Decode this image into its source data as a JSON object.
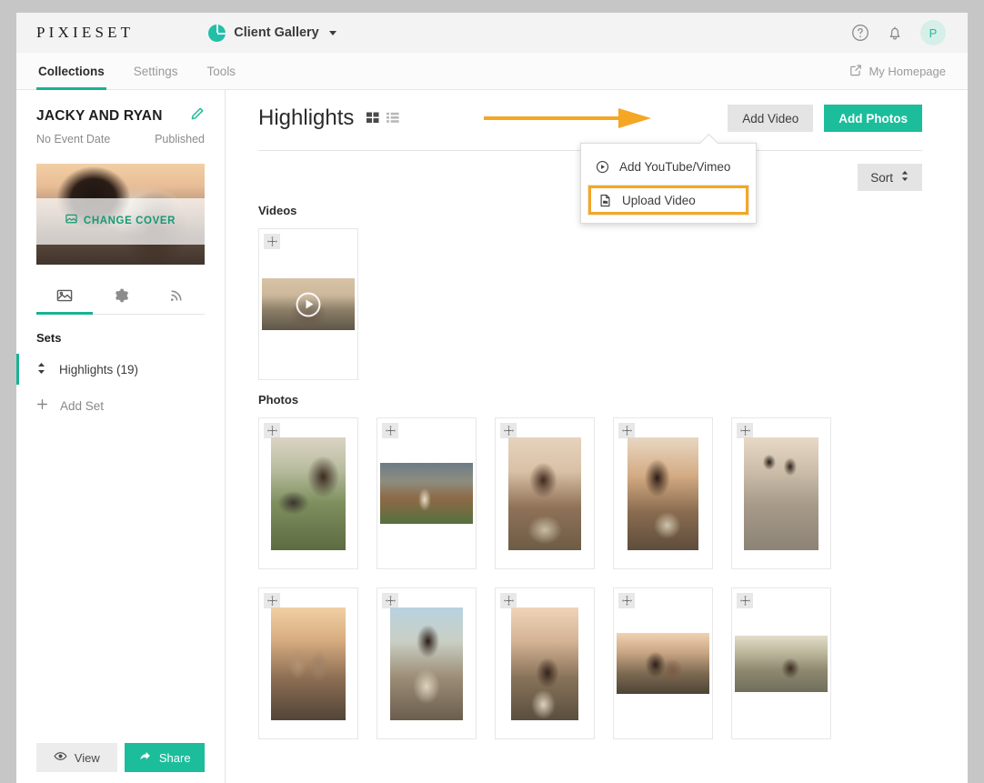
{
  "topbar": {
    "brand": "PIXIESET",
    "product": "Client Gallery",
    "logo_icon": "pixieset-logo-icon",
    "caret_icon": "chevron-down-icon",
    "help_icon": "help-circle-icon",
    "notifications_icon": "bell-icon",
    "avatar_initial": "P"
  },
  "nav": {
    "tabs": [
      {
        "label": "Collections",
        "active": true
      },
      {
        "label": "Settings",
        "active": false
      },
      {
        "label": "Tools",
        "active": false
      }
    ],
    "homepage_label": "My Homepage",
    "homepage_icon": "external-link-icon"
  },
  "sidebar": {
    "collection_title": "JACKY AND RYAN",
    "edit_icon": "pencil-icon",
    "event_date": "No Event Date",
    "status": "Published",
    "cover": {
      "change_label": "CHANGE COVER",
      "change_icon": "image-icon"
    },
    "tab_icons": [
      {
        "name": "photos-icon",
        "active": true
      },
      {
        "name": "gear-icon",
        "active": false
      },
      {
        "name": "rss-icon",
        "active": false
      }
    ],
    "sets_label": "Sets",
    "sets": [
      {
        "label": "Highlights (19)",
        "active": true,
        "icon": "sort-handle-icon"
      }
    ],
    "add_set_label": "Add Set",
    "add_set_icon": "plus-icon",
    "footer": {
      "view_label": "View",
      "view_icon": "eye-icon",
      "share_label": "Share",
      "share_icon": "share-arrow-icon"
    }
  },
  "main": {
    "title": "Highlights",
    "view_toggles": [
      {
        "name": "grid-view-icon",
        "active": true
      },
      {
        "name": "list-view-icon",
        "active": false
      }
    ],
    "add_video_label": "Add Video",
    "add_photos_label": "Add Photos",
    "sort_label": "Sort",
    "sort_icon": "sort-updown-icon",
    "videos_section_label": "Videos",
    "photos_section_label": "Photos",
    "dropdown": {
      "items": [
        {
          "label": "Add YouTube/Vimeo",
          "icon": "play-circle-icon",
          "highlighted": false
        },
        {
          "label": "Upload Video",
          "icon": "video-file-icon",
          "highlighted": true
        }
      ]
    },
    "annotation": {
      "arrow_color": "#f5a623",
      "highlight_color": "#f5a623"
    },
    "videos": [
      {
        "name": "video-thumbnail",
        "play_icon": "play-circle-icon"
      }
    ],
    "photos_row1": [
      {
        "name": "photo-thumbnail"
      },
      {
        "name": "photo-thumbnail"
      },
      {
        "name": "photo-thumbnail"
      },
      {
        "name": "photo-thumbnail"
      },
      {
        "name": "photo-thumbnail"
      }
    ],
    "photos_row2": [
      {
        "name": "photo-thumbnail"
      },
      {
        "name": "photo-thumbnail"
      },
      {
        "name": "photo-thumbnail"
      },
      {
        "name": "photo-thumbnail"
      },
      {
        "name": "photo-thumbnail"
      }
    ],
    "drag_icon": "drag-handle-icon"
  },
  "colors": {
    "accent_teal": "#1cbd9b",
    "annotation_orange": "#f5a623",
    "frame_gray": "#c6c6c6"
  }
}
